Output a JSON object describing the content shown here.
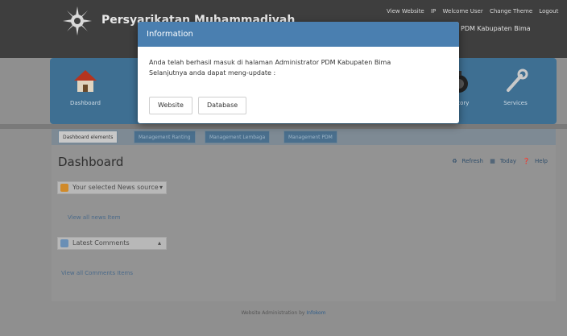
{
  "header": {
    "org_name": "Persyarikatan Muhammadiyah",
    "subtitle": "PDM Kabupaten Bima",
    "top_links": [
      "View Website",
      "IP",
      "Welcome User",
      "Change Theme",
      "Logout"
    ]
  },
  "icon_panel": {
    "items": [
      {
        "label": "Dashboard",
        "icon": "home-icon"
      },
      {
        "label": "History",
        "icon": "history-icon"
      },
      {
        "label": "Services",
        "icon": "wrench-icon"
      }
    ]
  },
  "tabs": [
    {
      "label": "Dashboard elements",
      "active": true
    },
    {
      "label": "Management Ranting",
      "active": false
    },
    {
      "label": "Management Lembaga",
      "active": false
    },
    {
      "label": "Management PDM",
      "active": false
    }
  ],
  "content": {
    "title": "Dashboard",
    "tools": {
      "refresh": "Refresh",
      "today": "Today",
      "help": "Help"
    },
    "news_box": {
      "title": "Your selected News source",
      "link": "View all news Item"
    },
    "comments_box": {
      "title": "Latest Comments",
      "link": "View all Comments Items"
    }
  },
  "footer": {
    "text": "Website Administration by",
    "link": "Infokom"
  },
  "modal": {
    "title": "Information",
    "message_line1": "Anda telah berhasil masuk di halaman Administrator PDM Kabupaten Bima",
    "message_line2": "Selanjutnya anda dapat meng-update :",
    "buttons": [
      "Website",
      "Database"
    ]
  },
  "colors": {
    "modal_header": "#4a7fb0",
    "icon_panel": "#3e6f92",
    "page_bg": "#8f8f8f"
  }
}
